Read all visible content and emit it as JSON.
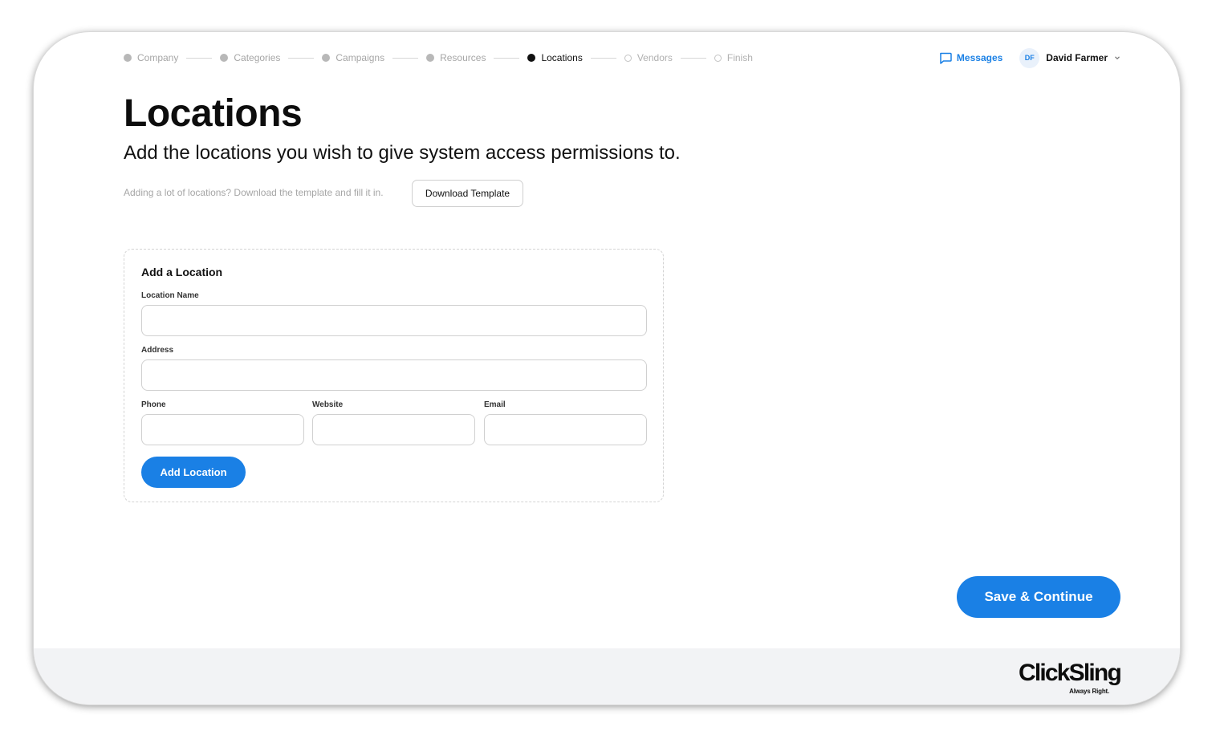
{
  "stepper": {
    "steps": [
      {
        "label": "Company",
        "state": "completed"
      },
      {
        "label": "Categories",
        "state": "completed"
      },
      {
        "label": "Campaigns",
        "state": "completed"
      },
      {
        "label": "Resources",
        "state": "completed"
      },
      {
        "label": "Locations",
        "state": "current"
      },
      {
        "label": "Vendors",
        "state": "upcoming"
      },
      {
        "label": "Finish",
        "state": "upcoming"
      }
    ]
  },
  "header": {
    "messages_label": "Messages",
    "user_initials": "DF",
    "user_name": "David Farmer"
  },
  "page": {
    "title": "Locations",
    "subtitle": "Add the locations you wish to give system access permissions to.",
    "template_hint": "Adding a lot of locations? Download the template and fill it in.",
    "download_template_label": "Download Template"
  },
  "form": {
    "title": "Add a Location",
    "location_name_label": "Location Name",
    "location_name_value": "",
    "address_label": "Address",
    "address_value": "",
    "phone_label": "Phone",
    "phone_value": "",
    "website_label": "Website",
    "website_value": "",
    "email_label": "Email",
    "email_value": "",
    "add_button_label": "Add Location"
  },
  "actions": {
    "save_continue_label": "Save & Continue"
  },
  "footer": {
    "brand_name": "ClickSling",
    "brand_tagline": "Always Right."
  },
  "colors": {
    "accent": "#1a80e5",
    "footer_bg": "#f2f3f5"
  }
}
